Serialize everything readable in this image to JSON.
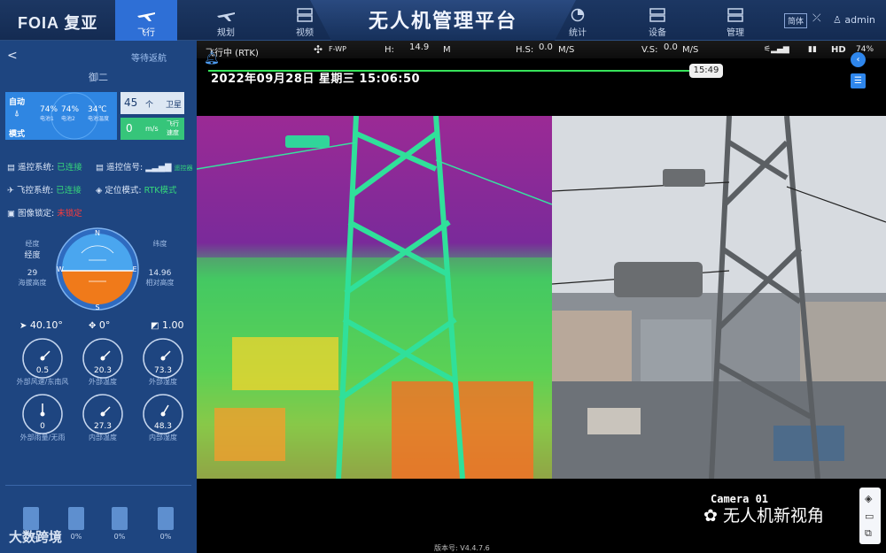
{
  "header": {
    "logo": "FOIA 复亚",
    "title": "无人机管理平台",
    "nav": [
      {
        "label": "飞行",
        "icon": "plane-icon"
      },
      {
        "label": "规划",
        "icon": "plane-plan-icon"
      },
      {
        "label": "视频",
        "icon": "video-icon"
      },
      {
        "label": "统计",
        "icon": "pie-chart-icon"
      },
      {
        "label": "设备",
        "icon": "device-icon"
      },
      {
        "label": "管理",
        "icon": "management-icon"
      }
    ],
    "lang_button": "简体",
    "username": "admin"
  },
  "sidebar": {
    "back": "<",
    "waiting": "等待返航",
    "drone_name": "御二",
    "mode_label_top": "自动",
    "mode_label_bottom": "模式",
    "battery1_value": "74%",
    "battery1_label": "电池1",
    "battery2_value": "74%",
    "battery2_label": "电池2",
    "battery_temp_value": "34℃",
    "battery_temp_label": "电池温度",
    "satellites": "45",
    "satellites_unit": "个",
    "satellites_label": "卫星",
    "speed": "0",
    "speed_unit": "m/s",
    "speed_label": "飞行速度",
    "status": [
      {
        "label": "遥控系统:",
        "value": "已连接"
      },
      {
        "label": "遥控信号:",
        "value": "遥控器"
      },
      {
        "label": "飞控系统:",
        "value": "已连接"
      },
      {
        "label": "定位模式:",
        "value": "RTK模式"
      },
      {
        "label": "图像锁定:",
        "value": "未锁定"
      }
    ],
    "left_label_top": "经度",
    "left_value_top": "经度",
    "altitude_value": "29",
    "altitude_label": "海拔高度",
    "right_label_top": "纬度",
    "rel_alt_value": "14.96",
    "rel_alt_label": "相对高度",
    "compass": {
      "N": "N",
      "S": "S",
      "E": "E",
      "W": "W"
    },
    "heading": "40.10°",
    "pitch": "0°",
    "zoom": "1.00",
    "gauges": [
      {
        "value": "0.5",
        "label": "外部风速/东南风"
      },
      {
        "value": "20.3",
        "label": "外部温度"
      },
      {
        "value": "73.3",
        "label": "外部湿度"
      },
      {
        "value": "0",
        "label": "外部雨量/无雨"
      },
      {
        "value": "27.3",
        "label": "内部温度"
      },
      {
        "value": "48.3",
        "label": "内部湿度"
      }
    ],
    "batteries": [
      "0%",
      "0%",
      "0%",
      "0%"
    ],
    "watermark": "大数跨境"
  },
  "video": {
    "flight_status": "飞行中 (RTK)",
    "mode": "F-WP",
    "h_label": "H:",
    "h_value": "14.9",
    "h_unit": "M",
    "hs_label": "H.S:",
    "hs_value": "0.0",
    "hs_unit": "M/S",
    "vs_label": "V.S:",
    "vs_value": "0.0",
    "vs_unit": "M/S",
    "battery": "74%",
    "hd": "HD",
    "datetime": "2022年09月28日 星期三 15:06:50",
    "timer": "15:49",
    "camera_label": "Camera 01",
    "watermark": "无人机新视角",
    "version": "版本号: V4.4.7.6"
  },
  "colors": {
    "accent": "#2e6fd6",
    "sidebar": "#1e4580",
    "status_ok": "#36d87a",
    "status_bad": "#ff3b3b"
  }
}
